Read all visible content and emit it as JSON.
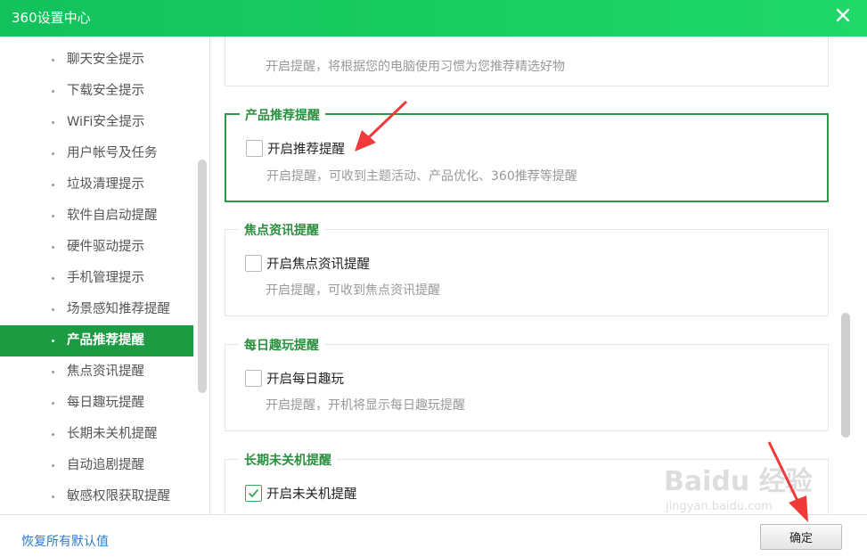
{
  "window": {
    "title": "360设置中心"
  },
  "sidebar": {
    "items": [
      {
        "label": "聊天安全提示"
      },
      {
        "label": "下载安全提示"
      },
      {
        "label": "WiFi安全提示"
      },
      {
        "label": "用户帐号及任务"
      },
      {
        "label": "垃圾清理提示"
      },
      {
        "label": "软件自启动提醒"
      },
      {
        "label": "硬件驱动提示"
      },
      {
        "label": "手机管理提示"
      },
      {
        "label": "场景感知推荐提醒"
      },
      {
        "label": "产品推荐提醒",
        "active": true
      },
      {
        "label": "焦点资讯提醒"
      },
      {
        "label": "每日趣玩提醒"
      },
      {
        "label": "长期未关机提醒"
      },
      {
        "label": "自动追剧提醒"
      },
      {
        "label": "敏感权限获取提醒"
      }
    ]
  },
  "main": {
    "partial_section": {
      "desc": "开启提醒，将根据您的电脑使用习惯为您推荐精选好物"
    },
    "sections": [
      {
        "title": "产品推荐提醒",
        "option": "开启推荐提醒",
        "checked": false,
        "desc": "开启提醒，可收到主题活动、产品优化、360推荐等提醒"
      },
      {
        "title": "焦点资讯提醒",
        "option": "开启焦点资讯提醒",
        "checked": false,
        "desc": "开启提醒，可收到焦点资讯提醒"
      },
      {
        "title": "每日趣玩提醒",
        "option": "开启每日趣玩",
        "checked": false,
        "desc": "开启提醒，开机将显示每日趣玩提醒"
      },
      {
        "title": "长期未关机提醒",
        "option": "开启未关机提醒",
        "checked": true,
        "desc": ""
      }
    ]
  },
  "footer": {
    "restore_label": "恢复所有默认值",
    "ok_label": "确定"
  },
  "watermark": {
    "main": "Baidu 经验",
    "sub": "jingyan.baidu.com"
  },
  "colors": {
    "titlebar": "#1ccf62",
    "active_item": "#1d9b43",
    "section_title": "#2a8f3e",
    "link": "#2b7cd6",
    "arrow": "#f03a3a"
  },
  "icons": {
    "close": "close-icon",
    "check": "checkmark-icon"
  }
}
